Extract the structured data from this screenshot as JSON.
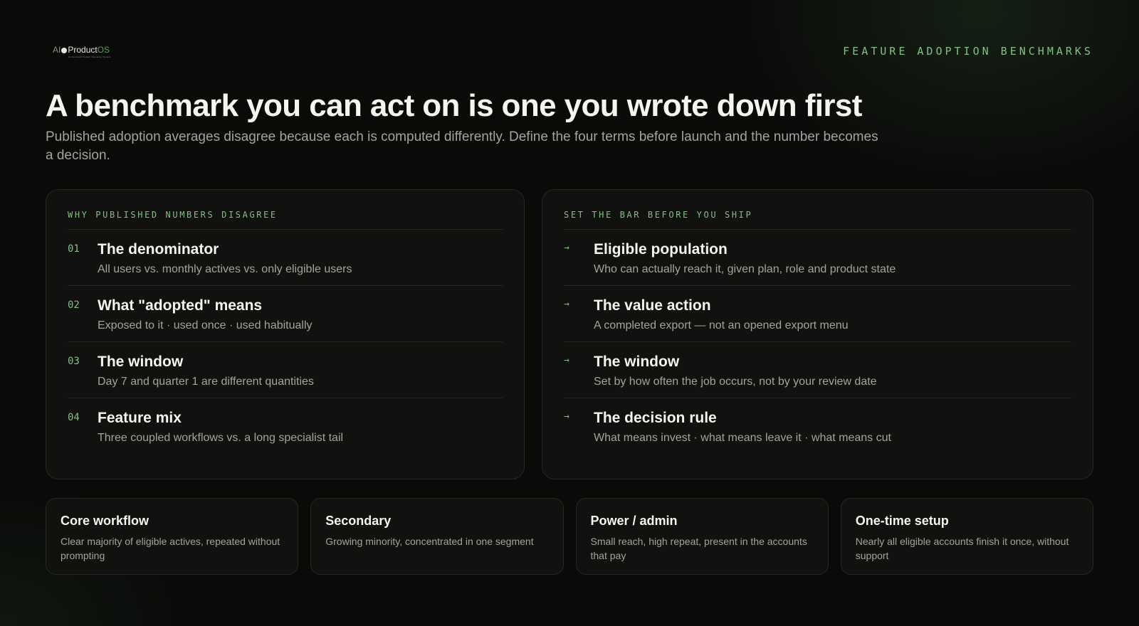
{
  "brand": {
    "logo_ai": "AI",
    "logo_product": "Product",
    "logo_os": "OS",
    "logo_tagline": "AI-Operated Product Operating System"
  },
  "header": {
    "eyebrow": "FEATURE ADOPTION BENCHMARKS",
    "title": "A benchmark you can act on is one you wrote down first",
    "subtitle": "Published adoption averages disagree because each is computed differently. Define the four terms before launch and the number becomes a decision."
  },
  "left_panel": {
    "label": "WHY PUBLISHED NUMBERS DISAGREE",
    "items": [
      {
        "num": "01",
        "title": "The denominator",
        "desc": "All users vs. monthly actives vs. only eligible users"
      },
      {
        "num": "02",
        "title": "What \"adopted\" means",
        "desc": "Exposed to it · used once · used habitually"
      },
      {
        "num": "03",
        "title": "The window",
        "desc": "Day 7 and quarter 1 are different quantities"
      },
      {
        "num": "04",
        "title": "Feature mix",
        "desc": "Three coupled workflows vs. a long specialist tail"
      }
    ]
  },
  "right_panel": {
    "label": "SET THE BAR BEFORE YOU SHIP",
    "items": [
      {
        "marker": "→",
        "title": "Eligible population",
        "desc": "Who can actually reach it, given plan, role and product state"
      },
      {
        "marker": "→",
        "title": "The value action",
        "desc": "A completed export — not an opened export menu"
      },
      {
        "marker": "→",
        "title": "The window",
        "desc": "Set by how often the job occurs, not by your review date"
      },
      {
        "marker": "→",
        "title": "The decision rule",
        "desc": "What means invest · what means leave it · what means cut"
      }
    ]
  },
  "tiles": [
    {
      "title": "Core workflow",
      "desc": "Clear majority of eligible actives, repeated without prompting"
    },
    {
      "title": "Secondary",
      "desc": "Growing minority, concentrated in one segment"
    },
    {
      "title": "Power / admin",
      "desc": "Small reach, high repeat, present in the accounts that pay"
    },
    {
      "title": "One-time setup",
      "desc": "Nearly all eligible accounts finish it once, without support"
    }
  ],
  "colors": {
    "accent": "#7cc47c",
    "background": "#0a0a09",
    "panel": "#11110f"
  }
}
